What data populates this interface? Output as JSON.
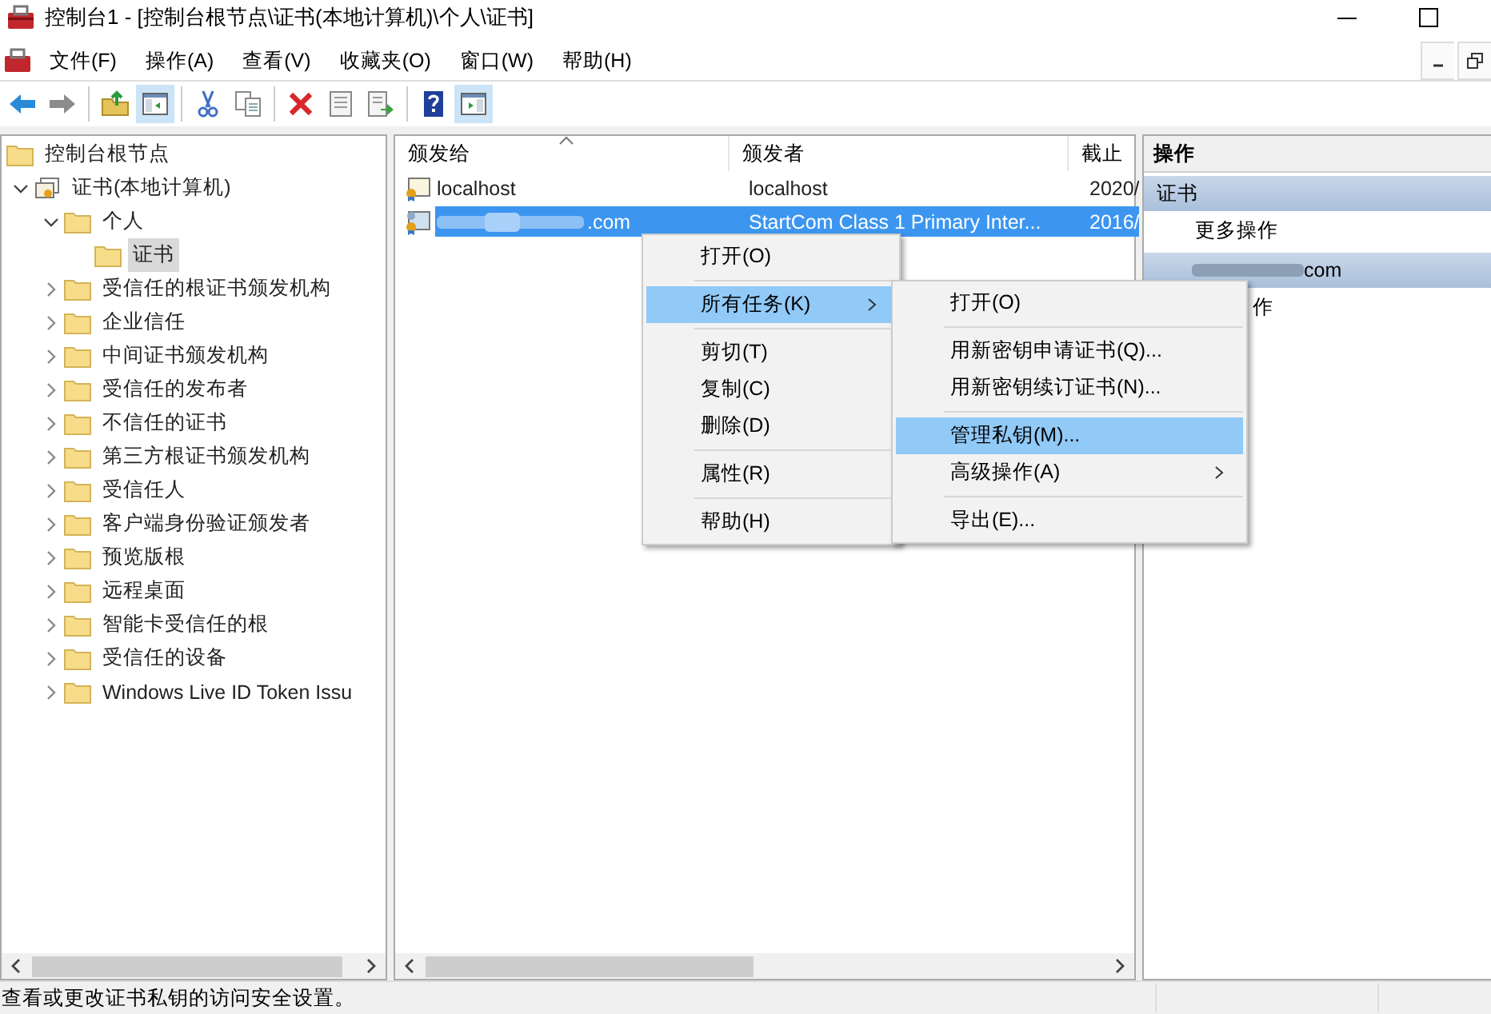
{
  "window": {
    "title": "控制台1 - [控制台根节点\\证书(本地计算机)\\个人\\证书]"
  },
  "menu_bar": [
    "文件(F)",
    "操作(A)",
    "查看(V)",
    "收藏夹(O)",
    "窗口(W)",
    "帮助(H)"
  ],
  "toolbar": [
    {
      "kind": "back",
      "pressed": false
    },
    {
      "kind": "forward",
      "pressed": false
    },
    {
      "kind": "sep"
    },
    {
      "kind": "up",
      "pressed": false
    },
    {
      "kind": "tree",
      "pressed": true
    },
    {
      "kind": "sep"
    },
    {
      "kind": "cut",
      "pressed": false
    },
    {
      "kind": "copy",
      "pressed": false
    },
    {
      "kind": "sep"
    },
    {
      "kind": "delete",
      "pressed": false
    },
    {
      "kind": "properties",
      "pressed": false
    },
    {
      "kind": "export",
      "pressed": false
    },
    {
      "kind": "sep"
    },
    {
      "kind": "help",
      "pressed": false
    },
    {
      "kind": "actions",
      "pressed": true
    }
  ],
  "tree": [
    {
      "label": "控制台根节点",
      "kind": "folder",
      "selected": false,
      "children": [
        {
          "label": "证书(本地计算机)",
          "kind": "store",
          "selected": false,
          "expanded": true,
          "children": [
            {
              "label": "个人",
              "kind": "folder",
              "selected": false,
              "expanded": true,
              "children": [
                {
                  "label": "证书",
                  "kind": "folder",
                  "selected": true
                }
              ]
            },
            {
              "label": "受信任的根证书颁发机构",
              "kind": "folder",
              "selected": false,
              "expanded": false
            },
            {
              "label": "企业信任",
              "kind": "folder",
              "selected": false,
              "expanded": false
            },
            {
              "label": "中间证书颁发机构",
              "kind": "folder",
              "selected": false,
              "expanded": false
            },
            {
              "label": "受信任的发布者",
              "kind": "folder",
              "selected": false,
              "expanded": false
            },
            {
              "label": "不信任的证书",
              "kind": "folder",
              "selected": false,
              "expanded": false
            },
            {
              "label": "第三方根证书颁发机构",
              "kind": "folder",
              "selected": false,
              "expanded": false
            },
            {
              "label": "受信任人",
              "kind": "folder",
              "selected": false,
              "expanded": false
            },
            {
              "label": "客户端身份验证颁发者",
              "kind": "folder",
              "selected": false,
              "expanded": false
            },
            {
              "label": "预览版根",
              "kind": "folder",
              "selected": false,
              "expanded": false
            },
            {
              "label": "远程桌面",
              "kind": "folder",
              "selected": false,
              "expanded": false
            },
            {
              "label": "智能卡受信任的根",
              "kind": "folder",
              "selected": false,
              "expanded": false
            },
            {
              "label": "受信任的设备",
              "kind": "folder",
              "selected": false,
              "expanded": false
            },
            {
              "label": "Windows Live ID Token Issu",
              "kind": "folder",
              "selected": false,
              "expanded": false
            }
          ]
        }
      ]
    }
  ],
  "list": {
    "columns": [
      "颁发给",
      "颁发者",
      "截止"
    ],
    "rows": [
      {
        "issued_to": "localhost",
        "redacted": false,
        "issuer": "localhost",
        "expires": "2020/",
        "selected": false,
        "kind": "cert"
      },
      {
        "issued_to": ".com",
        "redacted": true,
        "issuer": "StartCom Class 1 Primary Inter...",
        "expires": "2016/",
        "selected": true,
        "kind": "cert-key"
      }
    ]
  },
  "actions": {
    "title": "操作",
    "items": [
      {
        "kind": "group",
        "label": "证书",
        "redacted": false
      },
      {
        "kind": "action",
        "label": "更多操作"
      },
      {
        "kind": "group",
        "label": "com",
        "redacted": true
      },
      {
        "kind": "action-partial",
        "label": "作"
      }
    ]
  },
  "context_menu": [
    {
      "kind": "item",
      "label": "打开(O)",
      "selected": false
    },
    {
      "kind": "separator"
    },
    {
      "kind": "item",
      "label": "所有任务(K)",
      "selected": true,
      "submenu": true
    },
    {
      "kind": "separator"
    },
    {
      "kind": "item",
      "label": "剪切(T)",
      "selected": false
    },
    {
      "kind": "item",
      "label": "复制(C)",
      "selected": false
    },
    {
      "kind": "item",
      "label": "删除(D)",
      "selected": false
    },
    {
      "kind": "separator"
    },
    {
      "kind": "item",
      "label": "属性(R)",
      "selected": false
    },
    {
      "kind": "separator"
    },
    {
      "kind": "item",
      "label": "帮助(H)",
      "selected": false
    }
  ],
  "submenu": [
    {
      "kind": "item",
      "label": "打开(O)",
      "selected": false
    },
    {
      "kind": "separator"
    },
    {
      "kind": "item",
      "label": "用新密钥申请证书(Q)...",
      "selected": false
    },
    {
      "kind": "item",
      "label": "用新密钥续订证书(N)...",
      "selected": false
    },
    {
      "kind": "separator"
    },
    {
      "kind": "item",
      "label": "管理私钥(M)...",
      "selected": true
    },
    {
      "kind": "item",
      "label": "高级操作(A)",
      "selected": false,
      "submenu": true
    },
    {
      "kind": "separator"
    },
    {
      "kind": "item",
      "label": "导出(E)...",
      "selected": false
    }
  ],
  "status_bar": {
    "text": "查看或更改证书私钥的访问安全设置。"
  }
}
